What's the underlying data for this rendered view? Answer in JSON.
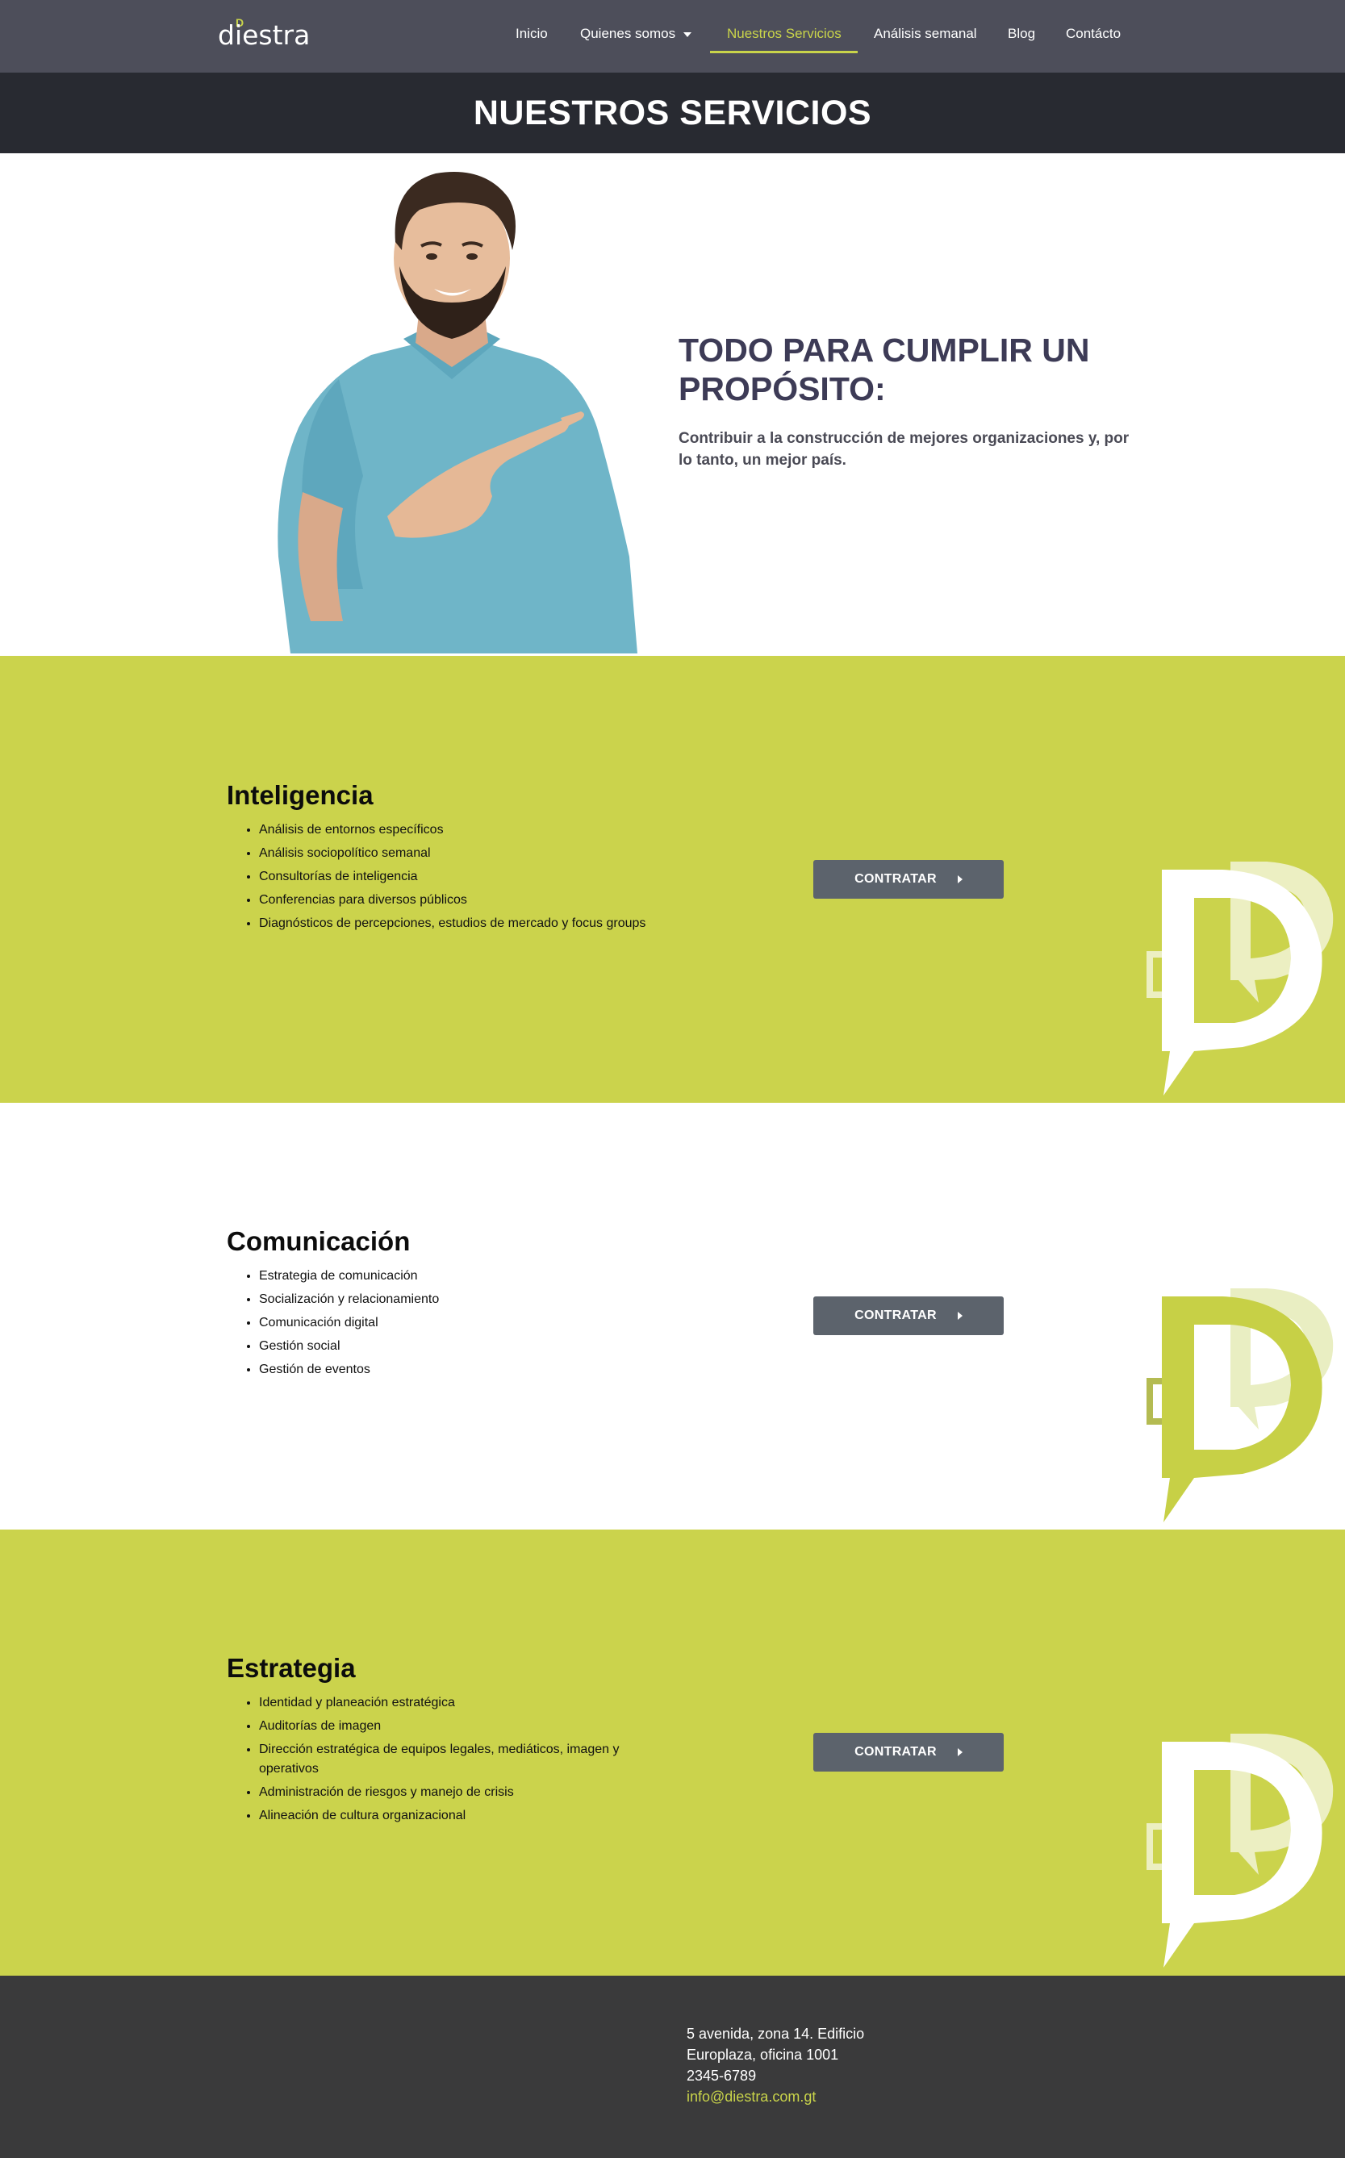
{
  "brand": {
    "name": "diestra",
    "initial": "D",
    "tagline": "",
    "accent": "#c9d44a"
  },
  "nav": {
    "items": [
      {
        "label": "Inicio"
      },
      {
        "label": "Quienes somos"
      },
      {
        "label": "Nuestros Servicios"
      },
      {
        "label": "Análisis semanal"
      },
      {
        "label": "Blog"
      },
      {
        "label": "Contácto"
      }
    ],
    "active": "Nuestros Servicios"
  },
  "page_title": "NUESTROS SERVICIOS",
  "hero": {
    "title": "TODO PARA CUMPLIR UN PROPÓSITO:",
    "subtitle": "Contribuir a la construcción de mejores organizaciones y, por lo tanto, un mejor país."
  },
  "services": [
    {
      "title": "Inteligencia",
      "items": [
        "Análisis de entornos específicos",
        "Análisis sociopolítico semanal",
        "Consultorías de inteligencia",
        "Conferencias para diversos públicos",
        "Diagnósticos de percepciones, estudios de mercado y focus groups"
      ],
      "button": "CONTRATAR"
    },
    {
      "title": "Comunicación",
      "items": [
        "Estrategia de comunicación",
        "Socialización y relacionamiento",
        "Comunicación digital",
        "Gestión social",
        "Gestión de eventos"
      ],
      "button": "CONTRATAR"
    },
    {
      "title": "Estrategia",
      "items": [
        "Identidad y planeación estratégica",
        "Auditorías de imagen",
        "Dirección estratégica de equipos legales, mediáticos, imagen y operativos",
        "Administración de riesgos y manejo de crisis",
        "Alineación de cultura organizacional"
      ],
      "button": "CONTRATAR"
    }
  ],
  "footer": {
    "address_line1": "5 avenida, zona 14. Edificio",
    "address_line2": "Europlaza, oficina 1001",
    "phone": "2345-6789",
    "email": "info@diestra.com.gt"
  },
  "colors": {
    "nav_bg": "#4d4e5a",
    "title_bg": "#282a31",
    "green": "#cbd34c",
    "button": "#5c636c",
    "footer_bg": "#3a3a3b",
    "hero_text": "#3d3b56"
  }
}
